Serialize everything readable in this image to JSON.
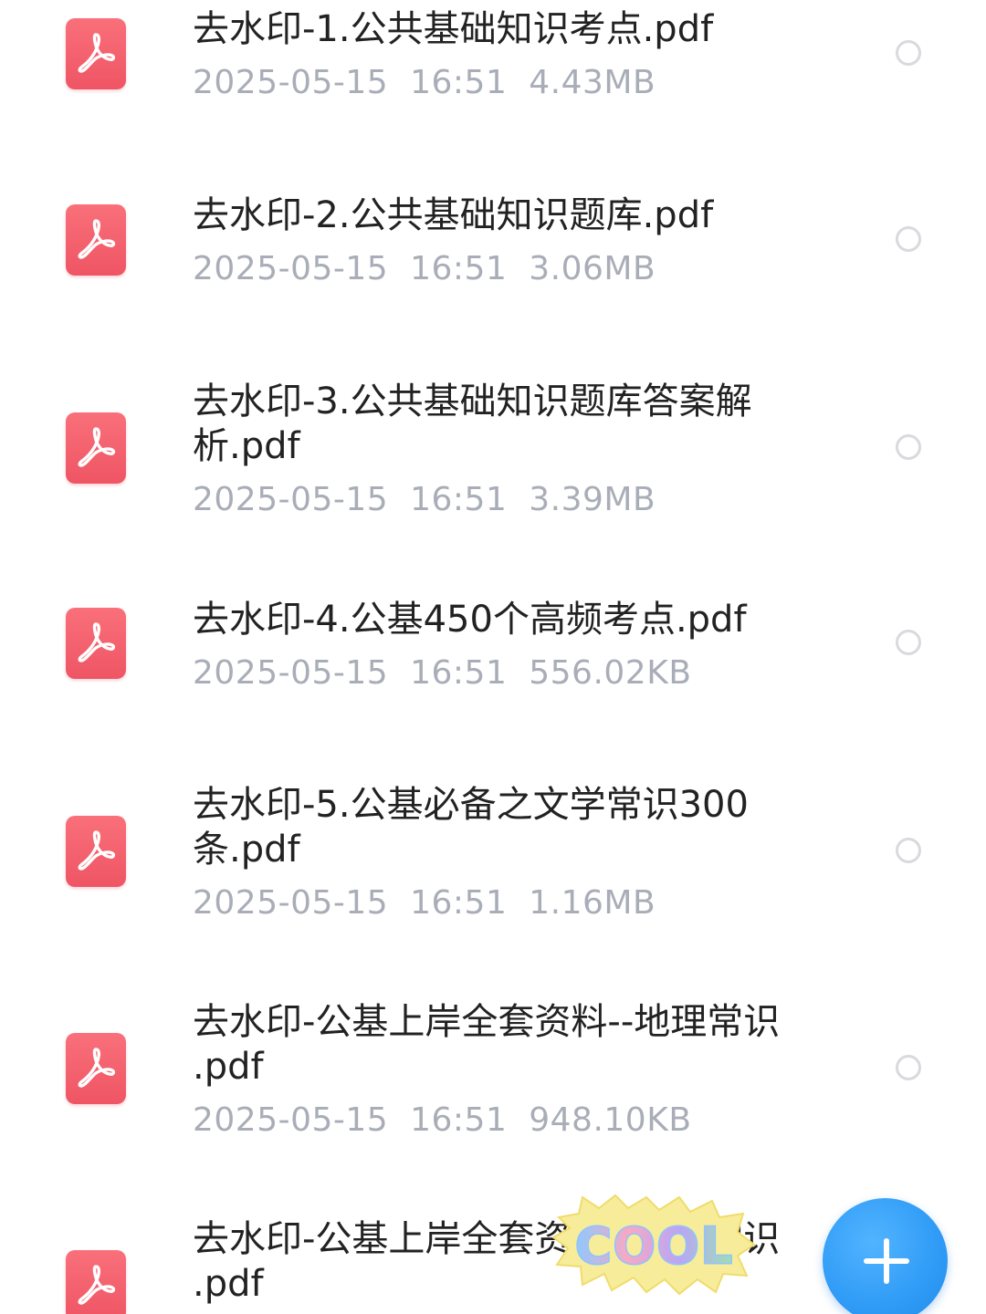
{
  "files": [
    {
      "name": "去水印-1.公共基础知识考点.pdf",
      "date": "2025-05-15",
      "time": "16:51",
      "size": "4.43MB",
      "icon": "pdf-icon"
    },
    {
      "name": "去水印-2.公共基础知识题库.pdf",
      "date": "2025-05-15",
      "time": "16:51",
      "size": "3.06MB",
      "icon": "pdf-icon"
    },
    {
      "name": "去水印-3.公共基础知识题库答案解析.pdf",
      "date": "2025-05-15",
      "time": "16:51",
      "size": "3.39MB",
      "icon": "pdf-icon"
    },
    {
      "name": "去水印-4.公基450个高频考点.pdf",
      "date": "2025-05-15",
      "time": "16:51",
      "size": "556.02KB",
      "icon": "pdf-icon"
    },
    {
      "name": "去水印-5.公基必备之文学常识300条.pdf",
      "date": "2025-05-15",
      "time": "16:51",
      "size": "1.16MB",
      "icon": "pdf-icon"
    },
    {
      "name": "去水印-公基上岸全套资料--地理常识 .pdf",
      "date": "2025-05-15",
      "time": "16:51",
      "size": "948.10KB",
      "icon": "pdf-icon"
    },
    {
      "name": "去水印-公基上岸全套资料--历史常识 .pdf",
      "date": "",
      "time": "",
      "size": "",
      "icon": "pdf-icon"
    }
  ],
  "fab": {
    "icon": "plus-icon",
    "color": "#2f9bf6"
  },
  "sticker": {
    "text": "COOL"
  },
  "colors": {
    "pdf_red": "#ef5564",
    "meta_gray": "#a9adb7",
    "radio_gray": "#d9d9de",
    "title_black": "#222222"
  }
}
